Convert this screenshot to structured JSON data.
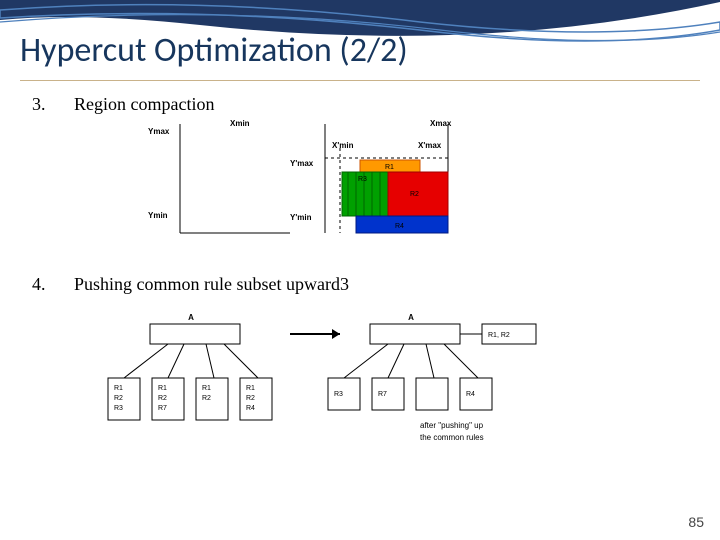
{
  "title": "Hypercut Optimization (2/2)",
  "items": [
    {
      "num": "3.",
      "text": "Region compaction"
    },
    {
      "num": "4.",
      "text": "Pushing common rule subset upward3"
    }
  ],
  "fig1": {
    "Ymax": "Ymax",
    "Ymin": "Ymin",
    "Xmin": "Xmin",
    "Xmax": "Xmax",
    "Xpmin": "X'min",
    "Xpmax": "X'max",
    "Ypmax": "Y'max",
    "Ypmin": "Y'min",
    "R1": "R1",
    "R2": "R2",
    "R3": "R3",
    "R4": "R4"
  },
  "fig2": {
    "A": "A",
    "arrow": "→",
    "R1": "R1",
    "R2": "R2",
    "R3": "R3",
    "R4": "R4",
    "R7": "R7",
    "common": "R1, R2",
    "caption1": "after \"pushing\" up",
    "caption2": "the common rules"
  },
  "page": "85"
}
